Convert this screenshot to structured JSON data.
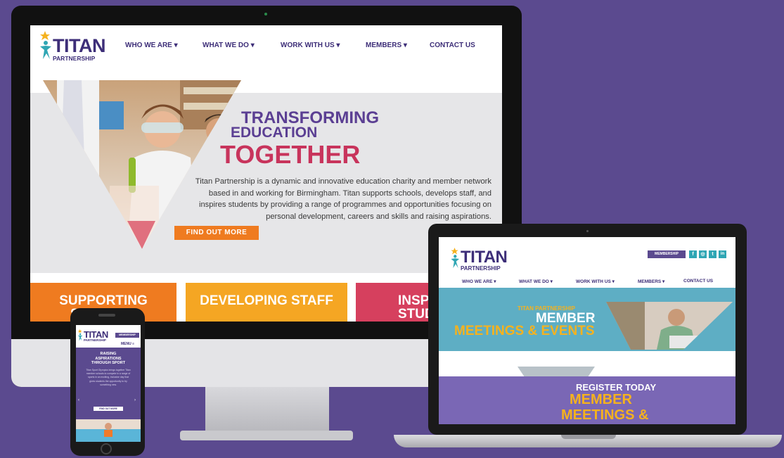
{
  "desktop": {
    "logo": {
      "title": "TITAN",
      "subtitle": "PARTNERSHIP"
    },
    "nav": [
      {
        "label": "WHO WE ARE ▾"
      },
      {
        "label": "WHAT WE DO ▾"
      },
      {
        "label": "WORK WITH US ▾"
      },
      {
        "label": "MEMBERS ▾"
      },
      {
        "label": "CONTACT US"
      }
    ],
    "hero": {
      "line1": "TRANSFORMING",
      "line2": "EDUCATION",
      "line3": "TOGETHER",
      "description": "Titan Partnership is a dynamic and innovative education charity and member network based in and working for Birmingham. Titan supports schools, develops staff, and inspires students by providing a range of programmes and opportunities focusing on personal development, careers and skills and raising aspirations.",
      "cta": "FIND OUT MORE"
    },
    "tiles": [
      {
        "label": "SUPPORTING SCHOOLS",
        "color": "#ef7b20"
      },
      {
        "label": "DEVELOPING STAFF",
        "color": "#f5a623"
      },
      {
        "label": "INSPIRING STUDENTS",
        "color": "#d6405e"
      }
    ]
  },
  "laptop": {
    "logo": {
      "title": "TITAN",
      "subtitle": "PARTNERSHIP"
    },
    "membership_button": "MEMBERSHIP",
    "social": [
      "f",
      "◎",
      "t",
      "in"
    ],
    "nav": [
      {
        "label": "WHO WE ARE ▾"
      },
      {
        "label": "WHAT WE DO ▾"
      },
      {
        "label": "WORK WITH US ▾"
      },
      {
        "label": "MEMBERS ▾"
      },
      {
        "label": "CONTACT US"
      }
    ],
    "banner1": {
      "kicker": "TITAN PARTNERSHIP",
      "line1": "MEMBER",
      "line2": "MEETINGS & EVENTS"
    },
    "banner2": {
      "line1": "REGISTER TODAY",
      "line2": "MEMBER",
      "line3": "MEETINGS &"
    }
  },
  "phone": {
    "logo": {
      "title": "TITAN",
      "subtitle": "PARTNERSHIP"
    },
    "membership_button": "MEMBERSHIP",
    "menu_label": "MENU ≡",
    "hero_title": "RAISING ASPIRATIONS THROUGH SPORT",
    "hero_text": "Titan Sport Olympics brings together Titan member schools to compete in a range of sports in an exciting, inclusive day that gives students the opportunity to try something new.",
    "cta": "FIND OUT MORE"
  },
  "colors": {
    "background": "#5b4a8f",
    "brand_purple": "#3d2e78",
    "accent_pink": "#c8345c",
    "accent_orange": "#ef7b20",
    "accent_teal": "#5eaec4"
  }
}
